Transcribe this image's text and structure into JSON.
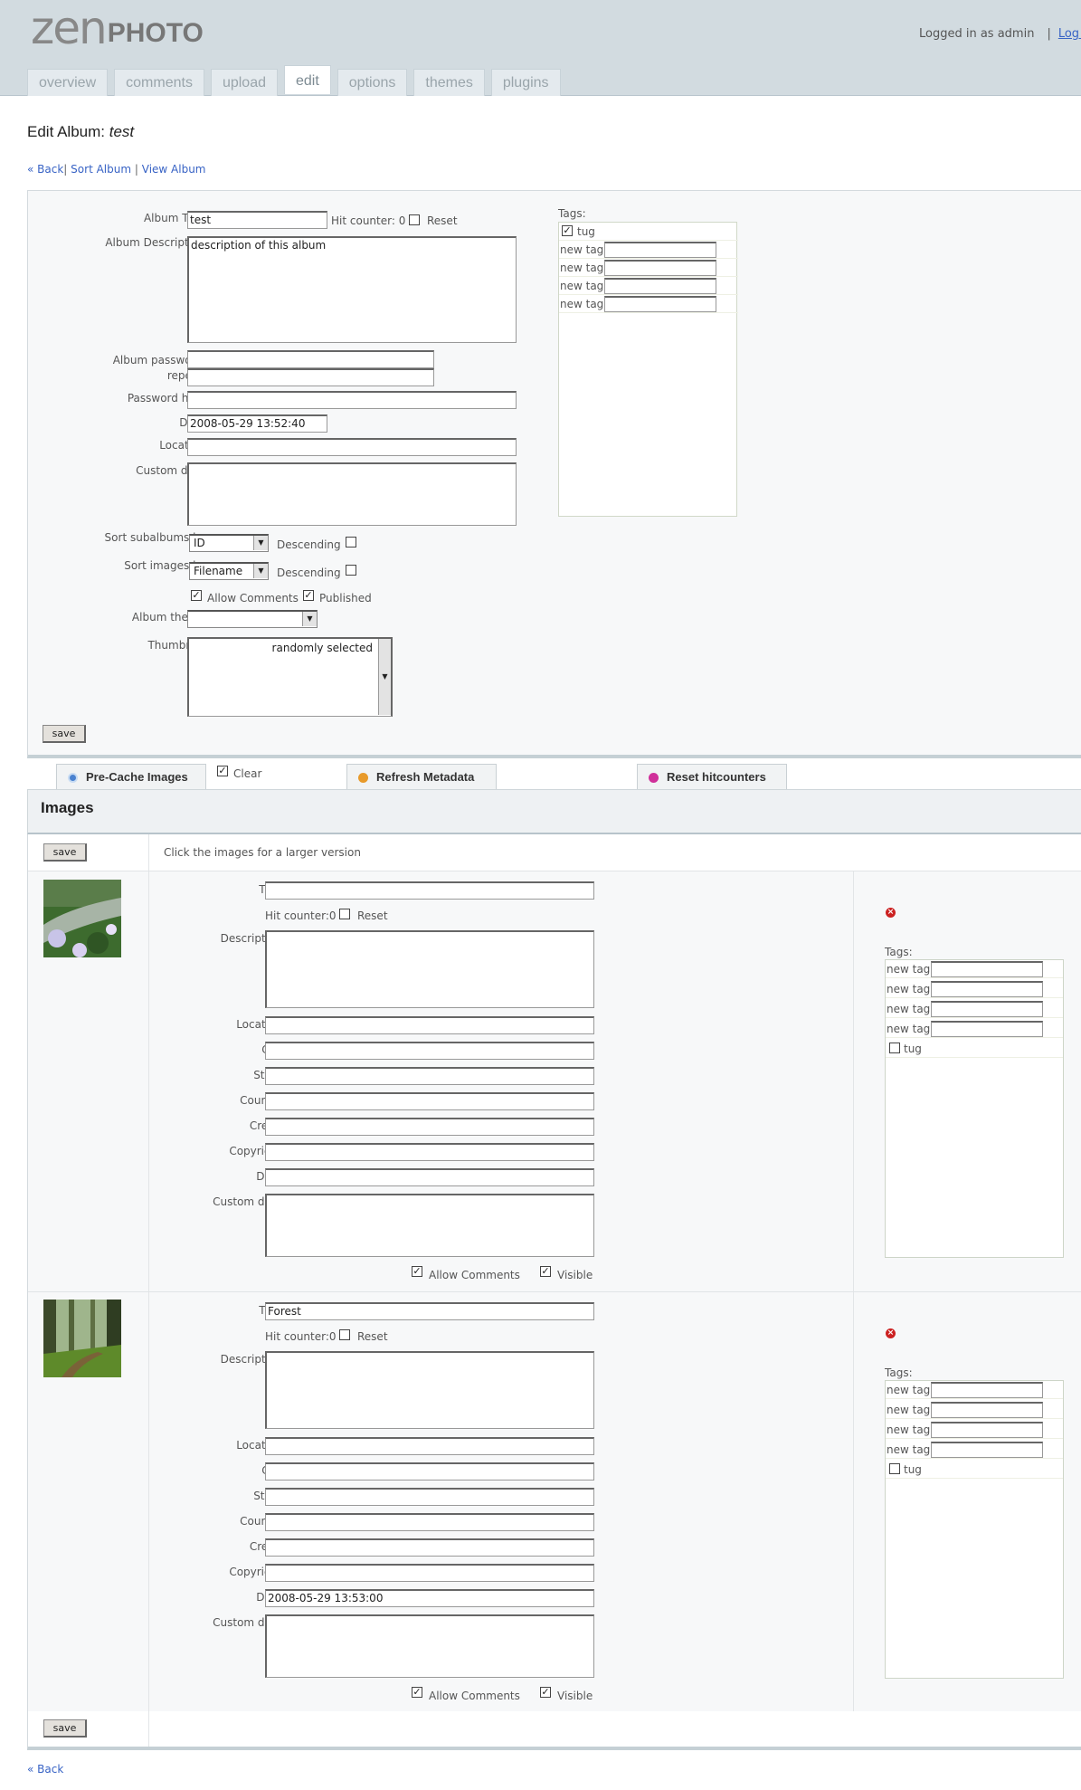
{
  "header": {
    "logo_left": "zen",
    "logo_right": "PHOTO",
    "logged_in": "Logged in as admin",
    "separator": "|",
    "logout": "Log Out"
  },
  "tabs": [
    "overview",
    "comments",
    "upload",
    "edit",
    "options",
    "themes",
    "plugins"
  ],
  "page": {
    "title_prefix": "Edit Album: ",
    "album_name": "test"
  },
  "subnav": {
    "back": "« Back",
    "sort": "Sort Album",
    "sep": "|",
    "view": "View Album"
  },
  "album": {
    "title_label": "Album Title:",
    "title_value": "test",
    "hit_counter": "Hit counter: 0",
    "reset_label": "Reset",
    "desc_label": "Album Description:",
    "desc_value": "description of this album",
    "password_label": "Album password:",
    "repeat_label": "repeat:",
    "hint_label": "Password hint:",
    "date_label": "Date:",
    "date_value": "2008-05-29 13:52:40",
    "location_label": "Location:",
    "custom_label": "Custom data:",
    "sort_sub_label": "Sort subalbums by:",
    "sort_sub_value": "ID",
    "descending_label": "Descending",
    "sort_img_label": "Sort images by:",
    "sort_img_value": "Filename",
    "allow_comments": "Allow Comments",
    "published": "Published",
    "theme_label": "Album theme:",
    "thumb_label": "Thumbnail:",
    "thumb_value": "randomly selected",
    "save": "save",
    "tags_label": "Tags:",
    "tags": [
      {
        "name": "tug",
        "checked": true
      }
    ],
    "new_tag_label": "new tag"
  },
  "actions": {
    "precache": "Pre-Cache Images",
    "clear": "Clear",
    "refresh": "Refresh Metadata",
    "reset_hits": "Reset hitcounters"
  },
  "images": {
    "heading": "Images",
    "save": "save",
    "hint": "Click the images for a larger version",
    "labels": {
      "title": "Title:",
      "hit_counter": "Hit counter:0",
      "reset": "Reset",
      "description": "Description:",
      "location": "Location:",
      "city": "City:",
      "state": "State:",
      "country": "Country:",
      "credit": "Credit:",
      "copyright": "Copyright:",
      "date": "Date:",
      "custom": "Custom data:",
      "allow_comments": "Allow Comments",
      "visible": "Visible",
      "tags": "Tags:",
      "new_tag": "new tag"
    },
    "items": [
      {
        "title": "",
        "date": "",
        "tag": "tug"
      },
      {
        "title": "Forest",
        "date": "2008-05-29 13:53:00",
        "tag": "tug"
      }
    ]
  },
  "footer": {
    "back": "« Back"
  },
  "colors": {
    "header_bg": "#d2dbe0",
    "link": "#3863c5",
    "panel_bg": "#f7f8f9"
  }
}
